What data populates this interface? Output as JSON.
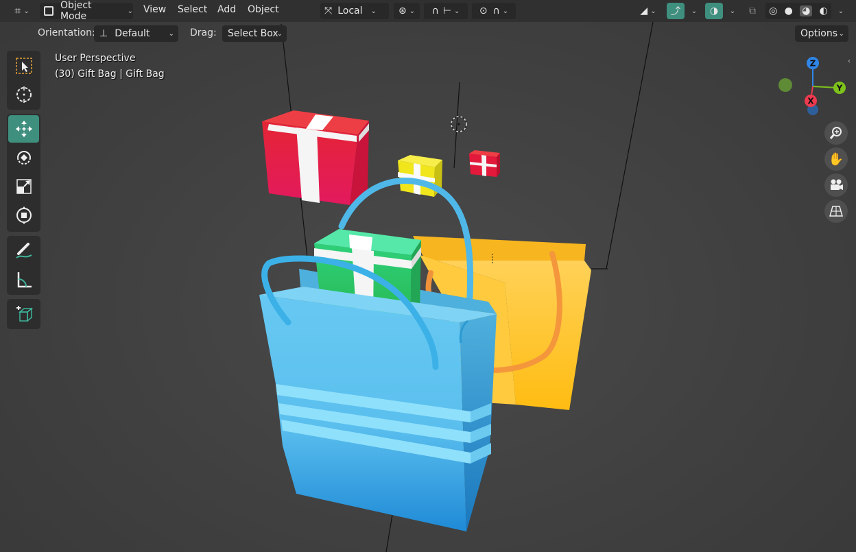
{
  "header": {
    "mode_label": "Object Mode",
    "menus": [
      "View",
      "Select",
      "Add",
      "Object"
    ],
    "transform_pivot_label": "Local"
  },
  "tool_settings": {
    "orientation_label": "Orientation:",
    "orientation_value": "Default",
    "drag_label": "Drag:",
    "drag_value": "Select Box",
    "options_label": "Options"
  },
  "viewport": {
    "view_name": "User Perspective",
    "object_info": "(30) Gift Bag | Gift Bag"
  },
  "gizmo": {
    "z": "Z",
    "y": "Y",
    "x": "X"
  },
  "toolbar": {
    "tools": [
      "select-box",
      "cursor",
      "move",
      "rotate",
      "scale",
      "transform",
      "annotate",
      "measure",
      "add-cube"
    ],
    "active_tool": "move"
  },
  "colors": {
    "accent": "#3f8f7f",
    "header_bg": "#303030",
    "viewport_bg": "#404040",
    "blue_bag": "#5ec3ee",
    "yellow_bag": "#ffc02a",
    "green_gift": "#35d67e",
    "red_gift": "#e0234a",
    "yellow_gift": "#f5e81f",
    "axis_x": "#ee3a4f",
    "axis_y": "#7ec21c",
    "axis_z": "#2f86e8"
  }
}
